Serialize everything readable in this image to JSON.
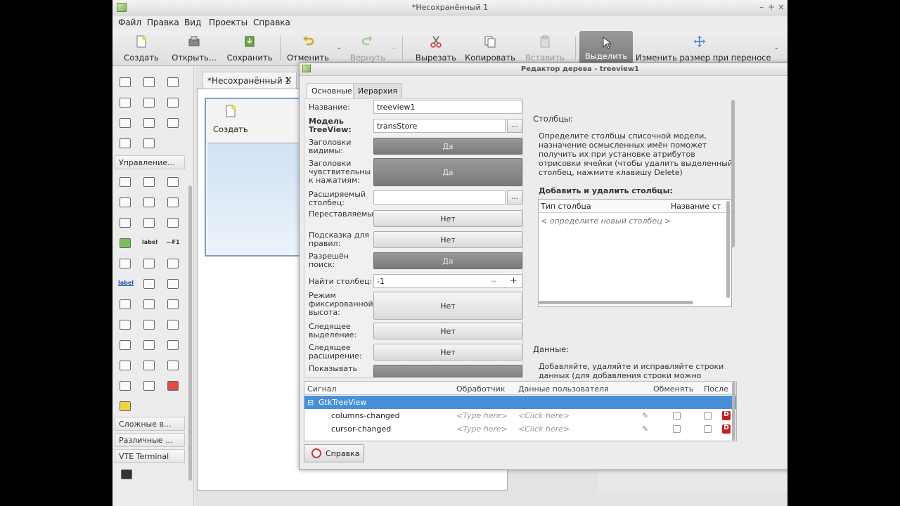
{
  "window": {
    "title": "*Несохранённый 1",
    "controls": [
      "–",
      "+",
      "×"
    ]
  },
  "menu": [
    "Файл",
    "Правка",
    "Вид",
    "Проекты",
    "Справка"
  ],
  "toolbar": {
    "create": "Создать",
    "open": "Открыть...",
    "save": "Сохранить",
    "undo": "Отменить",
    "redo": "Вернуть",
    "cut": "Вырезать",
    "copy": "Копировать",
    "paste": "Вставить",
    "select": "Выделить",
    "resize": "Изменить размер при переносе"
  },
  "palette": {
    "groups": [
      "Управление...",
      "Сложные в...",
      "Различные ...",
      "VTE Terminal"
    ],
    "label_word": "label",
    "f1_word": "—F1"
  },
  "document": {
    "tab": "*Несохранённый 1",
    "tab_close": "×",
    "design_button": "Создать"
  },
  "dialog": {
    "title": "Редактор дерева - treeview1",
    "tabs": [
      "Основные",
      "Иерархия"
    ],
    "props": {
      "name_label": "Название:",
      "name_value": "treeview1",
      "model_label": "Модель TreeView:",
      "model_value": "transStore",
      "dots": "...",
      "headers_visible_label": "Заголовки видимы:",
      "headers_visible": "Да",
      "headers_clickable_label": "Заголовки чувствительны к нажатиям:",
      "headers_clickable": "Да",
      "expander_label": "Расширяемый столбец:",
      "reorderable_label": "Переставляемые:",
      "reorderable": "Нет",
      "rules_hint_label": "Подсказка для правил:",
      "rules_hint": "Нет",
      "search_label": "Разрешён поиск:",
      "search": "Да",
      "search_col_label": "Найти столбец:",
      "search_col": "-1",
      "minus": "−",
      "plus": "+",
      "fixed_height_label": "Режим фиксированной высота:",
      "fixed_height": "Нет",
      "hover_sel_label": "Следящее выделение:",
      "hover_sel": "Нет",
      "hover_exp_label": "Следящее расширение:",
      "hover_exp": "Нет",
      "show_label": "Показывать"
    },
    "info": {
      "columns_heading": "Столбцы:",
      "columns_desc": "Определите столбцы списочной модели, назначение осмысленных имён поможет получить их при установке атрибутов отрисовки ячейки (чтобы удалить выделенный столбец, нажмите клавишу Delete)",
      "add_remove": "Добавить и удалить столбцы:",
      "col_type": "Тип столбца",
      "col_name": "Название ст",
      "new_col": "< определите новый столбец >",
      "data_heading": "Данные:",
      "data_desc": "Добавляйте, удаляйте и исправляйте строки данных (для добавления строки можно"
    },
    "signals": {
      "headers": [
        "Сигнал",
        "Обработчик",
        "Данные пользователя",
        "Обменять",
        "После"
      ],
      "group": "GtkTreeView",
      "rows": [
        {
          "name": "columns-changed",
          "handler": "<Type here>",
          "data": "<Click here>"
        },
        {
          "name": "cursor-changed",
          "handler": "<Type here>",
          "data": "<Click here>"
        }
      ],
      "delete_glyph": "D"
    },
    "help": "Справка"
  }
}
